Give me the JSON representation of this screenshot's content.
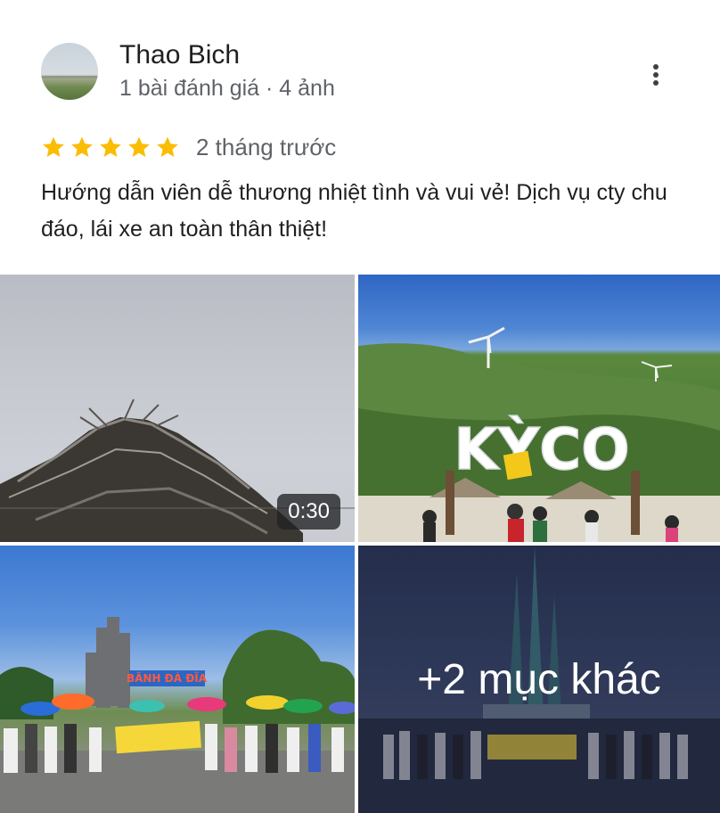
{
  "review": {
    "author_name": "Thao Bich",
    "author_meta": "1 bài đánh giá · 4 ảnh",
    "rating": 5,
    "rating_max": 5,
    "time_ago": "2 tháng trước",
    "text": "Hướng dẫn viên dễ thương nhiệt tình và vui vẻ! Dịch vụ cty chu đáo, lái xe an toàn thân thiệt!"
  },
  "icons": {
    "more": "more-vert-icon",
    "star": "star-icon"
  },
  "colors": {
    "star": "#fbbc04",
    "meta_text": "#5f6368",
    "primary_text": "#1f1f1f"
  },
  "photos": [
    {
      "kind": "video",
      "duration": "0:30"
    },
    {
      "kind": "photo",
      "sign_text": "KỲCO"
    },
    {
      "kind": "photo",
      "sign_text": "BÃNH ĐÁ ĐĨA"
    },
    {
      "kind": "more",
      "more_label": "+2 mục khác"
    }
  ]
}
